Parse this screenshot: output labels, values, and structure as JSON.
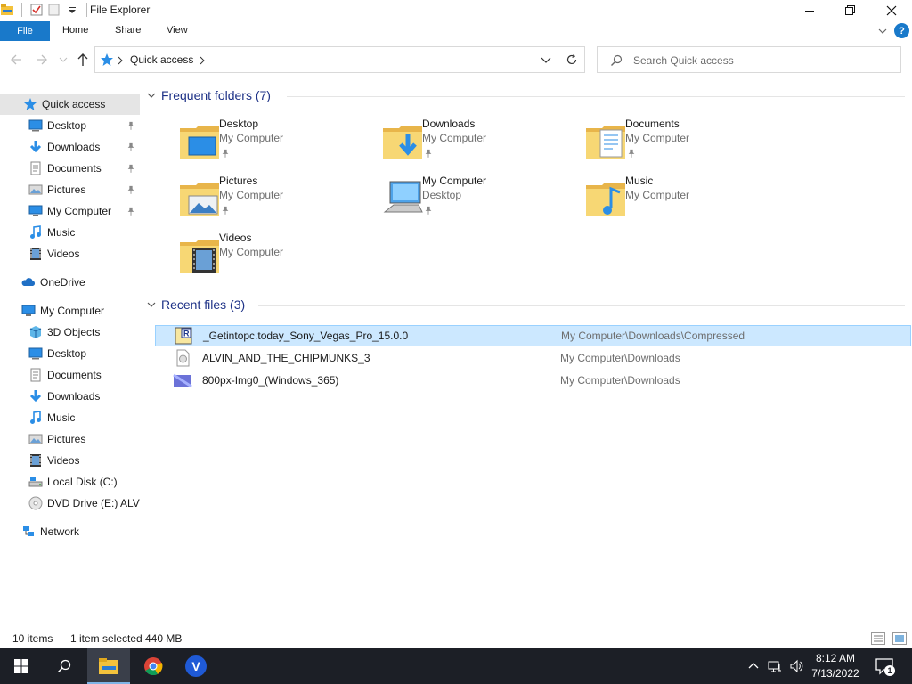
{
  "window": {
    "title": "File Explorer",
    "minimize_glyph": "—",
    "maximize_glyph": "❐",
    "close_glyph": "✕"
  },
  "ribbon": {
    "file": "File",
    "tabs": [
      "Home",
      "Share",
      "View"
    ],
    "help_glyph": "?"
  },
  "address": {
    "location": "Quick access",
    "search_placeholder": "Search Quick access"
  },
  "sidebar": {
    "quick_access": "Quick access",
    "quick_items": [
      {
        "label": "Desktop",
        "icon": "desktop-icon",
        "pinned": true
      },
      {
        "label": "Downloads",
        "icon": "downloads-icon",
        "pinned": true
      },
      {
        "label": "Documents",
        "icon": "documents-icon",
        "pinned": true
      },
      {
        "label": "Pictures",
        "icon": "pictures-icon",
        "pinned": true
      },
      {
        "label": "My Computer",
        "icon": "computer-icon",
        "pinned": true
      },
      {
        "label": "Music",
        "icon": "music-icon",
        "pinned": false
      },
      {
        "label": "Videos",
        "icon": "videos-icon",
        "pinned": false
      }
    ],
    "onedrive": "OneDrive",
    "my_computer": "My Computer",
    "computer_items": [
      {
        "label": "3D Objects",
        "icon": "3d-objects-icon"
      },
      {
        "label": "Desktop",
        "icon": "desktop-icon"
      },
      {
        "label": "Documents",
        "icon": "documents-icon"
      },
      {
        "label": "Downloads",
        "icon": "downloads-icon"
      },
      {
        "label": "Music",
        "icon": "music-icon"
      },
      {
        "label": "Pictures",
        "icon": "pictures-icon"
      },
      {
        "label": "Videos",
        "icon": "videos-icon"
      },
      {
        "label": "Local Disk (C:)",
        "icon": "local-disk-icon"
      },
      {
        "label": "DVD Drive (E:) ALVIN",
        "icon": "dvd-drive-icon"
      }
    ],
    "network": "Network"
  },
  "frequent": {
    "heading": "Frequent folders (7)",
    "folders": [
      {
        "name": "Desktop",
        "location": "My Computer",
        "pinned": true
      },
      {
        "name": "Downloads",
        "location": "My Computer",
        "pinned": true
      },
      {
        "name": "Documents",
        "location": "My Computer",
        "pinned": true
      },
      {
        "name": "Pictures",
        "location": "My Computer",
        "pinned": true
      },
      {
        "name": "My Computer",
        "location": "Desktop",
        "pinned": true
      },
      {
        "name": "Music",
        "location": "My Computer",
        "pinned": false
      },
      {
        "name": "Videos",
        "location": "My Computer",
        "pinned": false
      }
    ]
  },
  "recent": {
    "heading": "Recent files (3)",
    "files": [
      {
        "name": "_Getintopc.today_Sony_Vegas_Pro_15.0.0",
        "path": "My Computer\\Downloads\\Compressed",
        "selected": true
      },
      {
        "name": "ALVIN_AND_THE_CHIPMUNKS_3",
        "path": "My Computer\\Downloads",
        "selected": false
      },
      {
        "name": "800px-Img0_(Windows_365)",
        "path": "My Computer\\Downloads",
        "selected": false
      }
    ]
  },
  "status": {
    "items": "10 items",
    "selected": "1 item selected",
    "size": "440 MB"
  },
  "taskbar": {
    "time": "8:12 AM",
    "date": "7/13/2022",
    "notification_count": "1",
    "vegas_letter": "V"
  },
  "colors": {
    "accent": "#1979ca",
    "selection": "#cce8ff",
    "heading": "#1e3287",
    "taskbar": "#1c1f26"
  }
}
